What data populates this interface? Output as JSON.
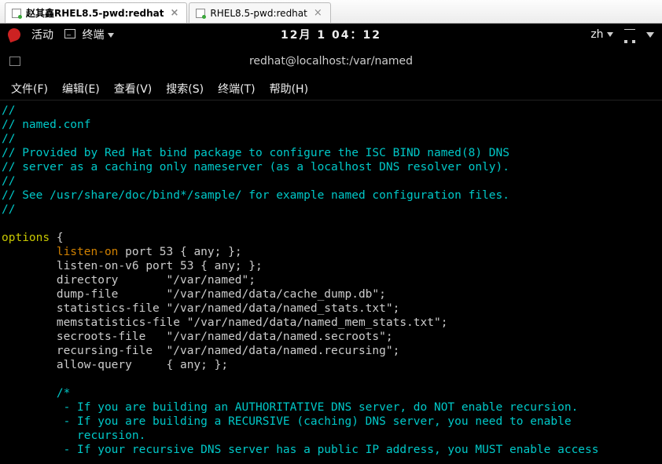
{
  "vm_tabs": [
    {
      "label": "赵其鑫RHEL8.5-pwd:redhat",
      "active": true
    },
    {
      "label": "RHEL8.5-pwd:redhat",
      "active": false
    }
  ],
  "gnome": {
    "activities": "活动",
    "terminal_app": "终端",
    "clock": "12月 1 04：12",
    "lang": "zh"
  },
  "window_title": "redhat@localhost:/var/named",
  "menus": {
    "file": "文件(F)",
    "edit": "编辑(E)",
    "view": "查看(V)",
    "search": "搜索(S)",
    "terminal": "终端(T)",
    "help": "帮助(H)"
  },
  "code": {
    "l1": "//",
    "l2": "// named.conf",
    "l3": "//",
    "l4": "// Provided by Red Hat bind package to configure the ISC BIND named(8) DNS",
    "l5": "// server as a caching only nameserver (as a localhost DNS resolver only).",
    "l6": "//",
    "l7": "// See /usr/share/doc/bind*/sample/ for example named configuration files.",
    "l8": "//",
    "opt_kw": "options",
    "opt_brace": " {",
    "listen_kw": "listen-on",
    "listen_rest": " port 53 { any; };",
    "l_v6": "        listen-on-v6 port 53 { any; };",
    "l_dir": "        directory       \"/var/named\";",
    "l_dump": "        dump-file       \"/var/named/data/cache_dump.db\";",
    "l_stat": "        statistics-file \"/var/named/data/named_stats.txt\";",
    "l_mem": "        memstatistics-file \"/var/named/data/named_mem_stats.txt\";",
    "l_sec": "        secroots-file   \"/var/named/data/named.secroots\";",
    "l_rec": "        recursing-file  \"/var/named/data/named.recursing\";",
    "l_allow": "        allow-query     { any; };",
    "c1": "        /*",
    "c2": "         - If you are building an AUTHORITATIVE DNS server, do NOT enable recursion.",
    "c3": "         - If you are building a RECURSIVE (caching) DNS server, you need to enable",
    "c4": "           recursion.",
    "c5": "         - If your recursive DNS server has a public IP address, you MUST enable access"
  }
}
